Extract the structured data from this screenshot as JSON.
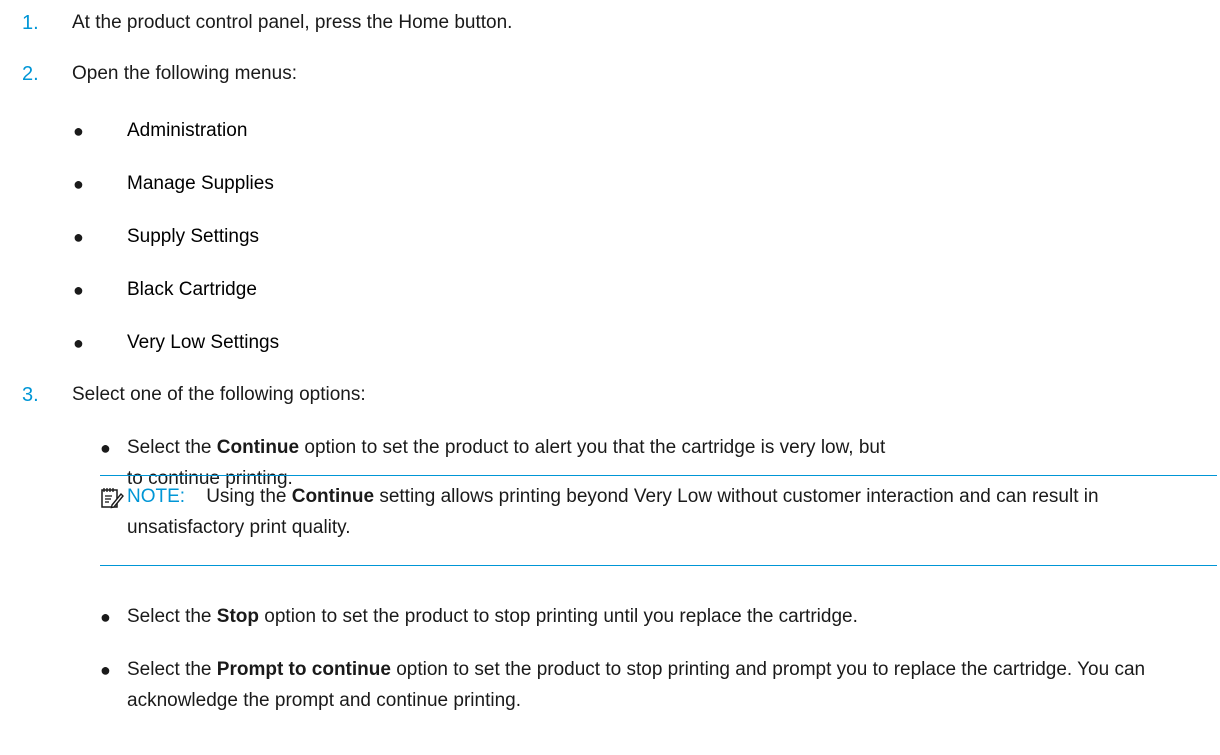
{
  "steps": [
    {
      "num": "1.",
      "text": "At the product control panel, press the Home button."
    },
    {
      "num": "2.",
      "text": "Open the following menus:"
    },
    {
      "num": "3.",
      "text": "Select one of the following options:"
    }
  ],
  "bullet_glyph": "●",
  "menus": [
    "Administration",
    "Manage Supplies",
    "Supply Settings",
    "Black Cartridge",
    "Very Low Settings"
  ],
  "options": [
    {
      "pre": "Select the ",
      "bold": "Continue",
      "post": " option to set the product to alert you that the cartridge is very low, but to continue printing."
    },
    {
      "pre": "Select the ",
      "bold": "Stop",
      "post": " option to set the product to stop printing until you replace the cartridge."
    },
    {
      "pre": "Select the ",
      "bold": "Prompt to continue",
      "post": " option to set the product to stop printing and prompt you to replace the cartridge. You can acknowledge the prompt and continue printing."
    }
  ],
  "note": {
    "icon": "note-icon",
    "label": "NOTE:",
    "pre": "Using the ",
    "bold": "Continue",
    "post": " setting allows printing beyond Very Low without customer interaction and can result in unsatisfactory print quality."
  },
  "colors": {
    "accent": "#0096d6",
    "text": "#1a1a1a"
  }
}
